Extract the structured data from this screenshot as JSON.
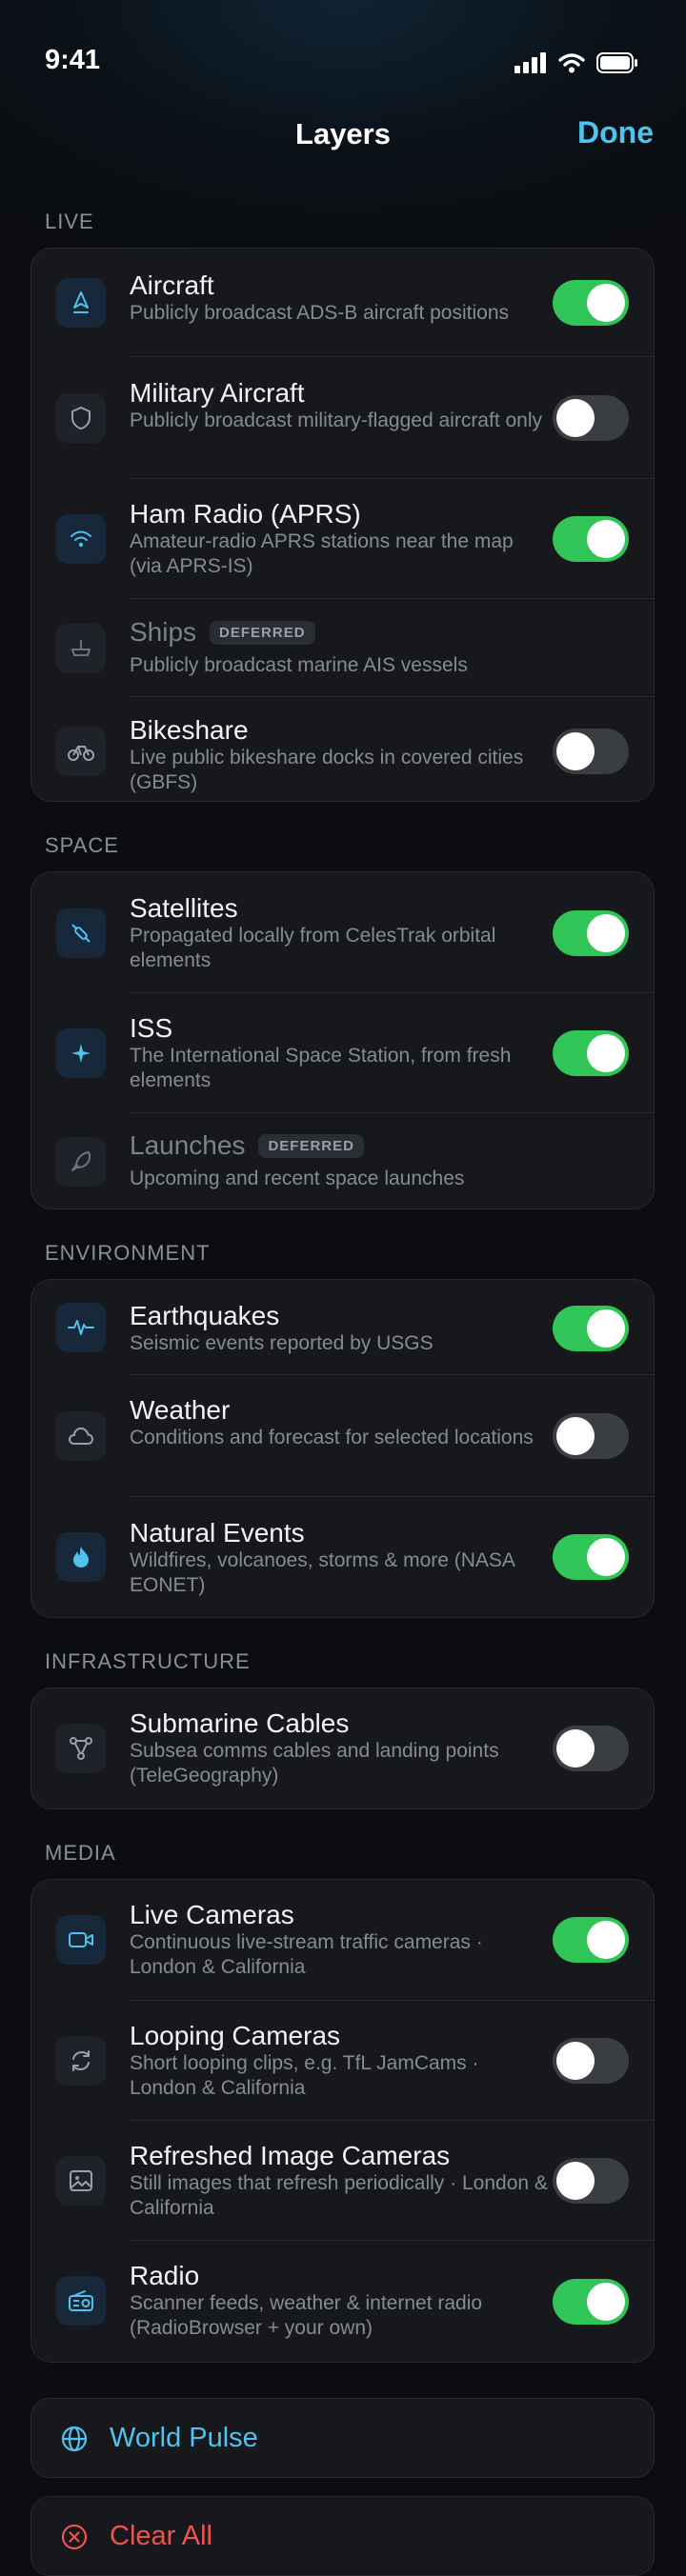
{
  "status": {
    "time": "9:41"
  },
  "nav": {
    "title": "Layers",
    "done_label": "Done"
  },
  "sections": {
    "live": {
      "header": "LIVE",
      "rows": [
        {
          "title": "Aircraft",
          "subtitle": "Publicly broadcast ADS-B aircraft positions",
          "toggle": true,
          "icon": "plane-icon"
        },
        {
          "title": "Military Aircraft",
          "subtitle": "Publicly broadcast military-flagged aircraft only",
          "toggle": false,
          "icon": "shield-icon"
        },
        {
          "title": "Ham Radio (APRS)",
          "subtitle": "Amateur-radio APRS stations near the map (via APRS-IS)",
          "toggle": true,
          "icon": "wifi-icon"
        },
        {
          "title": "Ships",
          "badge": "DEFERRED",
          "subtitle": "Publicly broadcast marine AIS vessels",
          "deferred": true,
          "icon": "ship-icon"
        },
        {
          "title": "Bikeshare",
          "subtitle": "Live public bikeshare docks in covered cities (GBFS)",
          "toggle": false,
          "icon": "bicycle-icon"
        }
      ]
    },
    "space": {
      "header": "SPACE",
      "rows": [
        {
          "title": "Satellites",
          "subtitle": "Propagated locally from CelesTrak orbital elements",
          "toggle": true,
          "icon": "satellite-icon"
        },
        {
          "title": "ISS",
          "subtitle": "The International Space Station, from fresh elements",
          "toggle": true,
          "icon": "sparkle-icon"
        },
        {
          "title": "Launches",
          "badge": "DEFERRED",
          "subtitle": "Upcoming and recent space launches",
          "deferred": true,
          "icon": "rocket-icon"
        }
      ]
    },
    "environment": {
      "header": "ENVIRONMENT",
      "rows": [
        {
          "title": "Earthquakes",
          "subtitle": "Seismic events reported by USGS",
          "toggle": true,
          "icon": "seismic-wave-icon"
        },
        {
          "title": "Weather",
          "subtitle": "Conditions and forecast for selected locations",
          "toggle": false,
          "icon": "cloud-icon"
        },
        {
          "title": "Natural Events",
          "subtitle": "Wildfires, volcanoes, storms & more (NASA EONET)",
          "toggle": true,
          "icon": "flame-icon"
        }
      ]
    },
    "infrastructure": {
      "header": "INFRASTRUCTURE",
      "rows": [
        {
          "title": "Submarine Cables",
          "subtitle": "Subsea comms cables and landing points (TeleGeography)",
          "toggle": false,
          "icon": "network-icon"
        }
      ]
    },
    "media": {
      "header": "MEDIA",
      "rows": [
        {
          "title": "Live Cameras",
          "subtitle": "Continuous live-stream traffic cameras · London & California",
          "toggle": true,
          "icon": "video-camera-icon"
        },
        {
          "title": "Looping Cameras",
          "subtitle": "Short looping clips, e.g. TfL JamCams · London & California",
          "toggle": false,
          "icon": "loop-arrows-icon"
        },
        {
          "title": "Refreshed Image Cameras",
          "subtitle": "Still images that refresh periodically · London & California",
          "toggle": false,
          "icon": "image-icon"
        },
        {
          "title": "Radio",
          "subtitle": "Scanner feeds, weather & internet radio (RadioBrowser + your own)",
          "toggle": true,
          "icon": "radio-icon"
        }
      ]
    }
  },
  "actions": {
    "world_pulse": {
      "label": "World Pulse",
      "color": "#4fc3f0",
      "icon": "globe-icon"
    },
    "clear_all": {
      "label": "Clear All",
      "color": "#ef5350",
      "icon": "close-circle-icon"
    }
  },
  "colors": {
    "toggle_on": "#30c556",
    "toggle_off": "#3a3d42",
    "accent": "#4fc3f0"
  }
}
